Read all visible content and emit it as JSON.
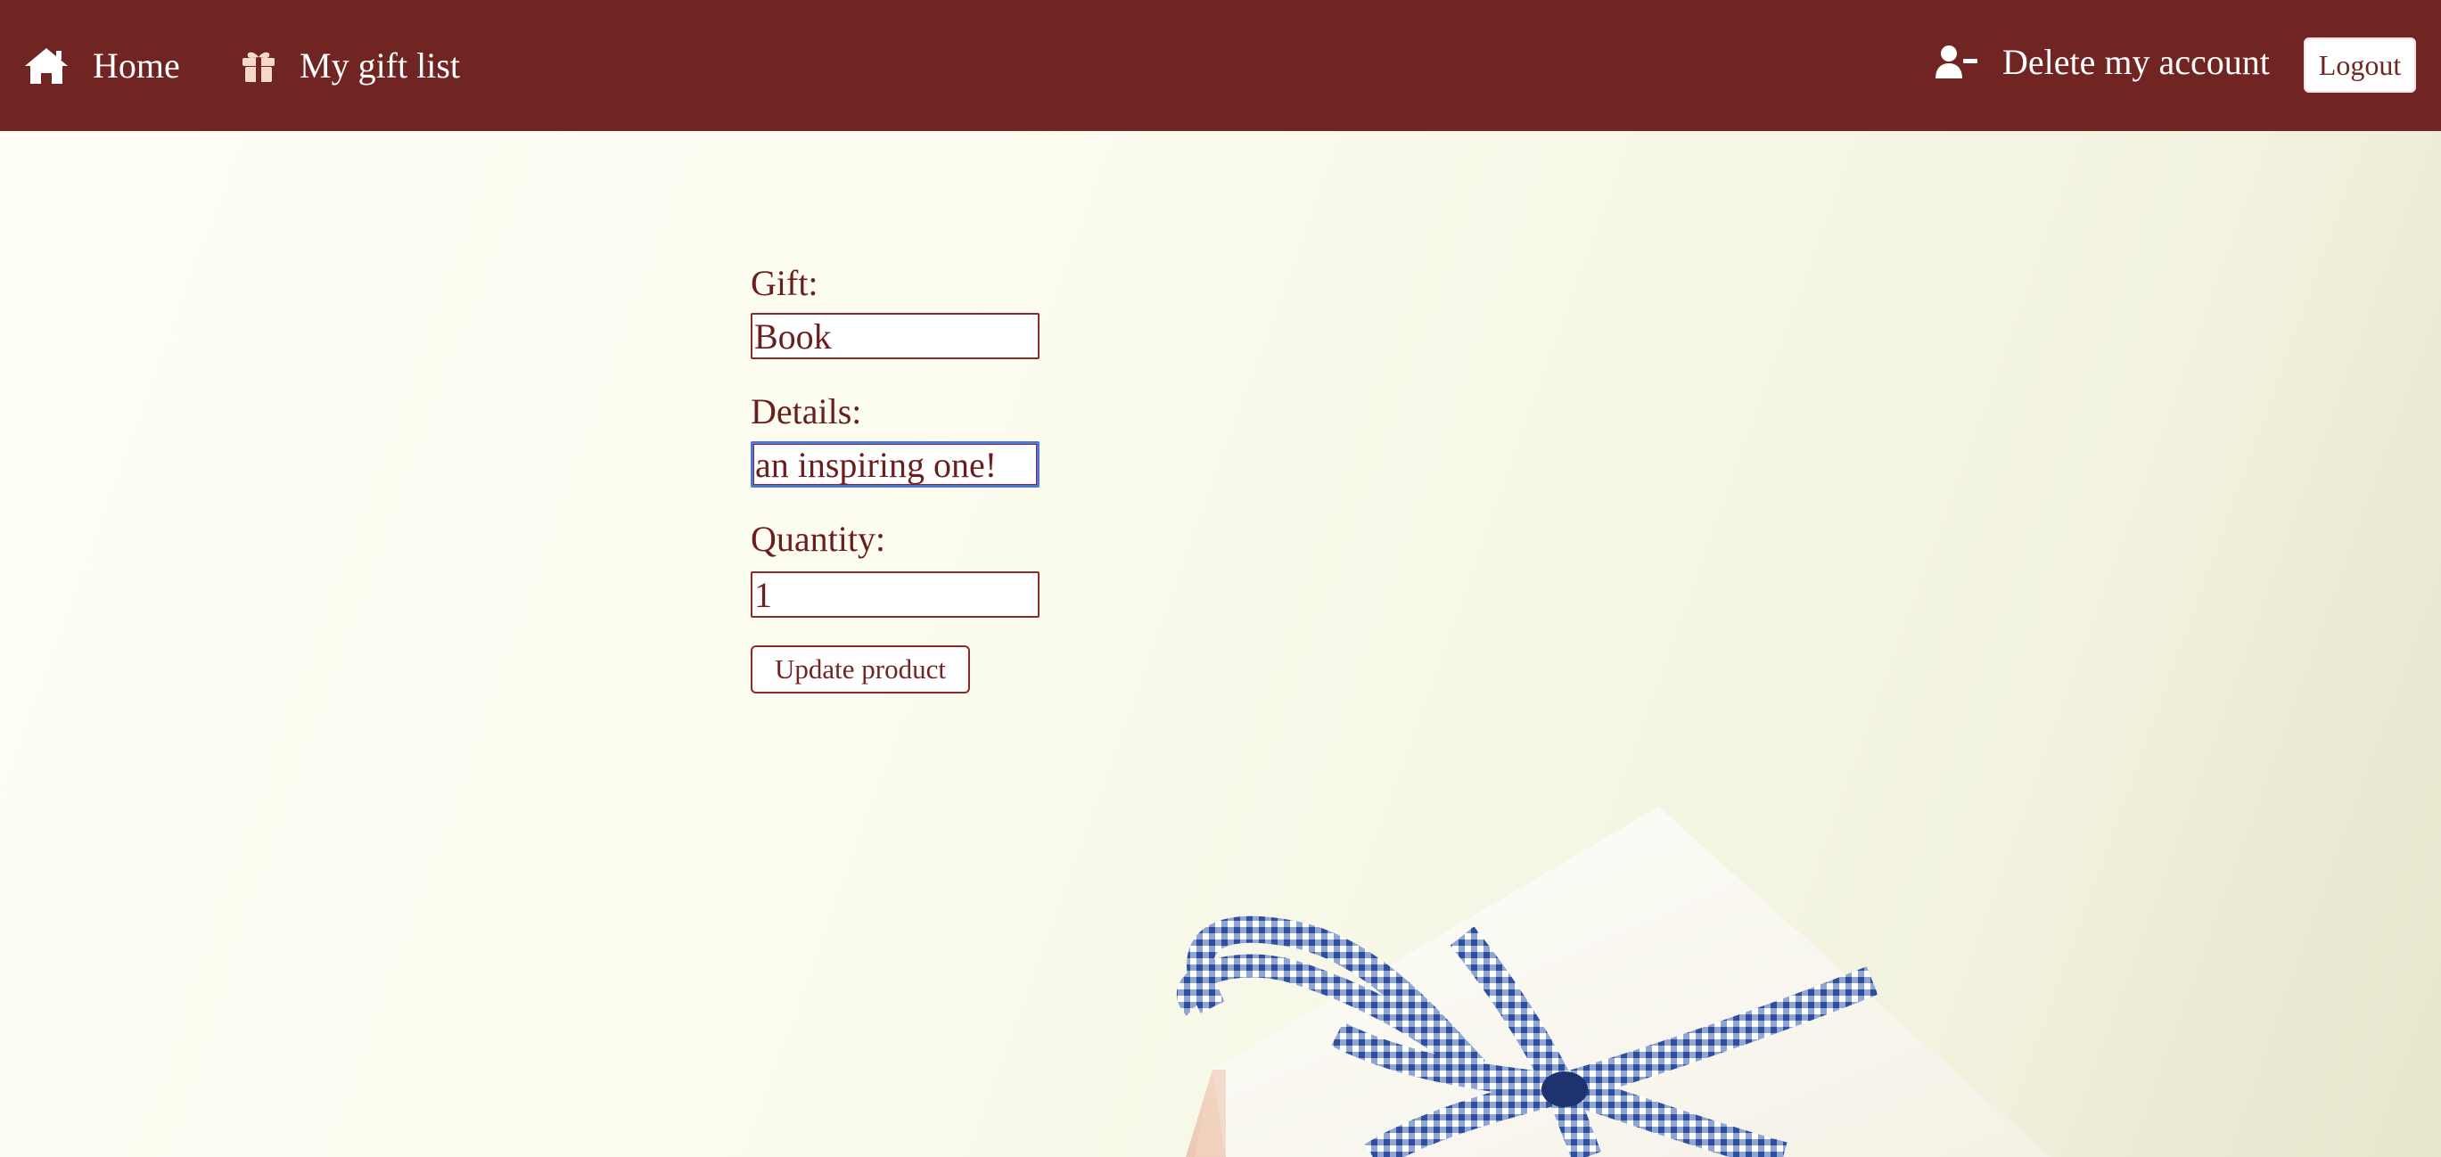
{
  "nav": {
    "home_label": "Home",
    "home_icon": "home-icon",
    "giftlist_label": "My gift list",
    "giftlist_icon": "gift-icon",
    "delete_account_label": "Delete my account",
    "delete_account_icon": "user-minus-icon",
    "logout_label": "Logout"
  },
  "form": {
    "gift_label": "Gift:",
    "gift_value": "Book",
    "details_label": "Details:",
    "details_value": "an inspiring one!",
    "quantity_label": "Quantity:",
    "quantity_value": "1",
    "submit_label": "Update product"
  },
  "colors": {
    "navbar": "#712523",
    "accent": "#712523",
    "text": "#6a1f1d",
    "focus_ring": "#4a78d8",
    "background": "#fbfbee"
  }
}
